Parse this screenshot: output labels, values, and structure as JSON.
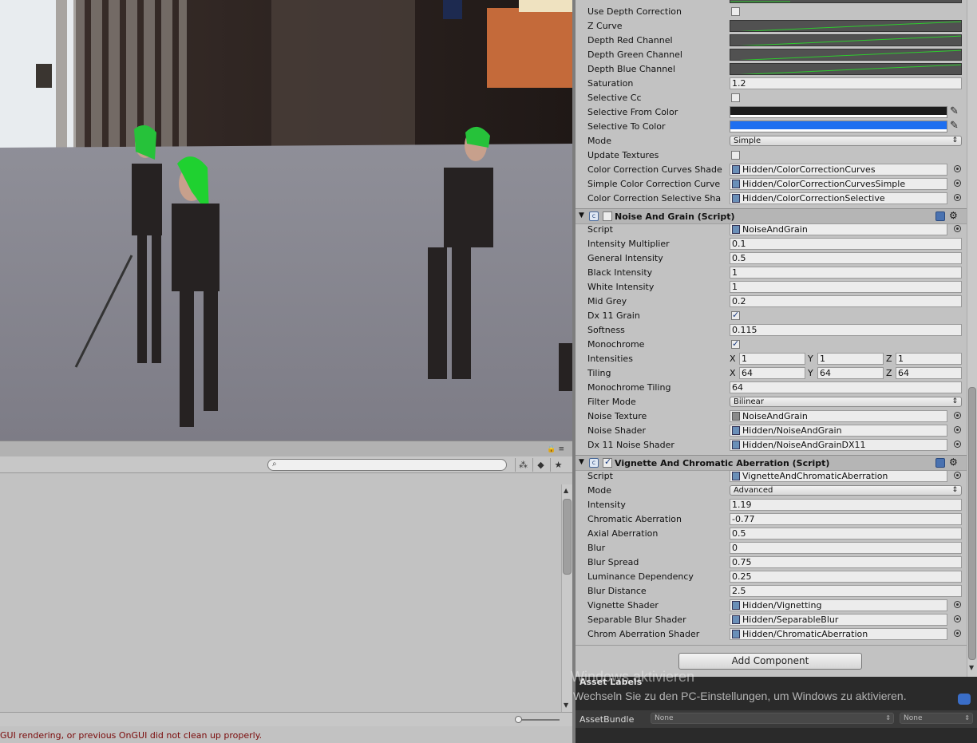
{
  "cc_rows": [
    {
      "label": "Use Depth Correction",
      "kind": "check",
      "checked": false
    },
    {
      "label": "Z Curve",
      "kind": "curve"
    },
    {
      "label": "Depth Red Channel",
      "kind": "curve"
    },
    {
      "label": "Depth Green Channel",
      "kind": "curve"
    },
    {
      "label": "Depth Blue Channel",
      "kind": "curve"
    },
    {
      "label": "Saturation",
      "kind": "text",
      "value": "1.2"
    },
    {
      "label": "Selective Cc",
      "kind": "check",
      "checked": false
    },
    {
      "label": "Selective From Color",
      "kind": "color",
      "color": "#1b1b1b"
    },
    {
      "label": "Selective To Color",
      "kind": "color",
      "color": "#1e6ff0"
    },
    {
      "label": "Mode",
      "kind": "popup",
      "value": "Simple"
    },
    {
      "label": "Update Textures",
      "kind": "check",
      "checked": false
    },
    {
      "label": "Color Correction Curves Shade",
      "kind": "obj",
      "value": "Hidden/ColorCorrectionCurves"
    },
    {
      "label": "Simple Color Correction Curve",
      "kind": "obj",
      "value": "Hidden/ColorCorrectionCurvesSimple"
    },
    {
      "label": "Color Correction Selective Sha",
      "kind": "obj",
      "value": "Hidden/ColorCorrectionSelective"
    }
  ],
  "noise": {
    "title": "Noise And Grain (Script)",
    "enabled": false,
    "rows": [
      {
        "label": "Script",
        "kind": "obj",
        "value": "NoiseAndGrain"
      },
      {
        "label": "Intensity Multiplier",
        "kind": "text",
        "value": "0.1"
      },
      {
        "label": "General Intensity",
        "kind": "text",
        "value": "0.5"
      },
      {
        "label": "Black Intensity",
        "kind": "text",
        "value": "1"
      },
      {
        "label": "White Intensity",
        "kind": "text",
        "value": "1"
      },
      {
        "label": "Mid Grey",
        "kind": "text",
        "value": "0.2"
      },
      {
        "label": "Dx 11 Grain",
        "kind": "check",
        "checked": true
      },
      {
        "label": "Softness",
        "kind": "text",
        "value": "0.115"
      },
      {
        "label": "Monochrome",
        "kind": "check",
        "checked": true
      },
      {
        "label": "Intensities",
        "kind": "vec",
        "x": "1",
        "y": "1",
        "z": "1"
      },
      {
        "label": "Tiling",
        "kind": "vec",
        "x": "64",
        "y": "64",
        "z": "64"
      },
      {
        "label": "Monochrome Tiling",
        "kind": "text",
        "value": "64"
      },
      {
        "label": "Filter Mode",
        "kind": "popup",
        "value": "Bilinear"
      },
      {
        "label": "Noise Texture",
        "kind": "obj",
        "value": "NoiseAndGrain",
        "gray": true
      },
      {
        "label": "Noise Shader",
        "kind": "obj",
        "value": "Hidden/NoiseAndGrain"
      },
      {
        "label": "Dx 11 Noise Shader",
        "kind": "obj",
        "value": "Hidden/NoiseAndGrainDX11"
      }
    ]
  },
  "vignette": {
    "title": "Vignette And Chromatic Aberration (Script)",
    "enabled": true,
    "rows": [
      {
        "label": "Script",
        "kind": "obj",
        "value": "VignetteAndChromaticAberration"
      },
      {
        "label": "Mode",
        "kind": "popup",
        "value": "Advanced"
      },
      {
        "label": "Intensity",
        "kind": "text",
        "value": "1.19"
      },
      {
        "label": "Chromatic Aberration",
        "kind": "text",
        "value": "-0.77"
      },
      {
        "label": "Axial Aberration",
        "kind": "text",
        "value": "0.5"
      },
      {
        "label": "Blur",
        "kind": "text",
        "value": "0"
      },
      {
        "label": "Blur Spread",
        "kind": "text",
        "value": "0.75"
      },
      {
        "label": "Luminance Dependency",
        "kind": "text",
        "value": "0.25"
      },
      {
        "label": "Blur Distance",
        "kind": "text",
        "value": "2.5"
      },
      {
        "label": "Vignette Shader",
        "kind": "obj",
        "value": "Hidden/Vignetting"
      },
      {
        "label": "Separable Blur Shader",
        "kind": "obj",
        "value": "Hidden/SeparableBlur"
      },
      {
        "label": "Chrom Aberration Shader",
        "kind": "obj",
        "value": "Hidden/ChromaticAberration"
      }
    ]
  },
  "add_component_label": "Add Component",
  "asset_labels_title": "Asset Labels",
  "asset_bundle_label": "AssetBundle",
  "asset_bundle_value": "None",
  "asset_bundle_variant": "None",
  "watermark_line1": "Windows aktivieren",
  "watermark_line2": "Wechseln Sie zu den PC-Einstellungen, um Windows zu aktivieren.",
  "status_message": "GUI rendering, or previous OnGUI did not clean up properly.",
  "icons": {
    "search": "magnifier-icon",
    "filter": "filter-icon",
    "label": "tag-icon",
    "favorite": "star-icon",
    "lock": "lock-icon",
    "menu": "menu-icon",
    "gear": "gear-icon",
    "help": "help-icon",
    "picker": "eyedropper-icon",
    "target": "object-picker-icon"
  },
  "colors": {
    "curve_line": "#2ecc2e",
    "status_text": "#7a0a0a",
    "inspector_bg": "#c2c2c2"
  }
}
